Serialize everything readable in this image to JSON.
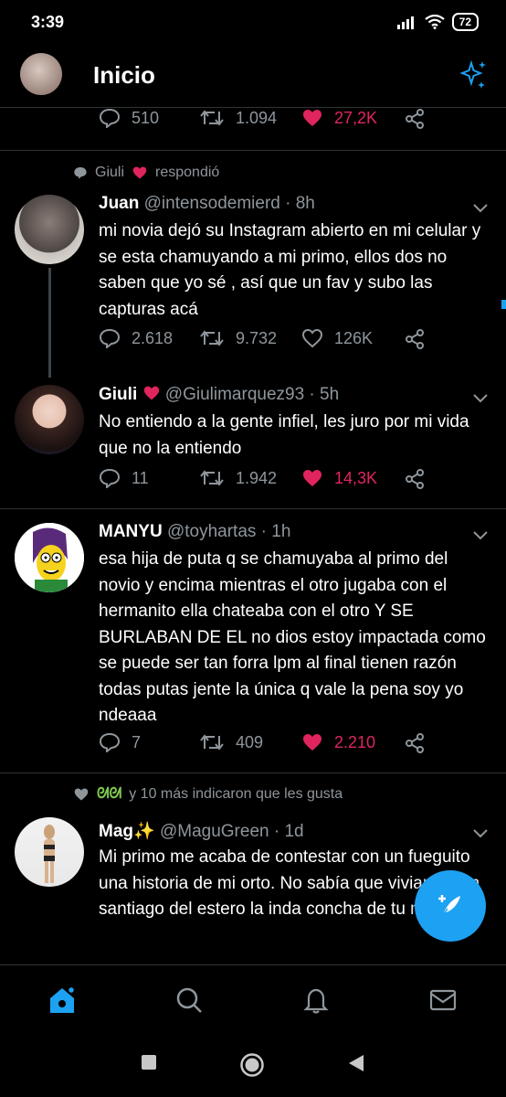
{
  "status_bar": {
    "time": "3:39",
    "battery": "72"
  },
  "header": {
    "title": "Inicio"
  },
  "top_stats": {
    "replies": "510",
    "retweets": "1.094",
    "likes": "27,2K"
  },
  "tweets": [
    {
      "context": "respondió",
      "context_user": "Giuli",
      "name": "Juan",
      "handle": "@intensodemierd · 8h",
      "text": "mi novia dejó su Instagram abierto en mi celular y se esta chamuyando a mi primo, ellos dos no saben que yo sé , así que un fav y subo las capturas acá",
      "replies": "2.618",
      "retweets": "9.732",
      "likes": "126K",
      "liked": false
    },
    {
      "name": "Giuli",
      "handle": "@Giulimarquez93 · 5h",
      "text": "No entiendo a la gente infiel, les juro por mi vida que no la entiendo",
      "replies": "11",
      "retweets": "1.942",
      "likes": "14,3K",
      "liked": true
    },
    {
      "name": "MANYU",
      "handle": "@toyhartas · 1h",
      "text": "esa hija de puta q se chamuyaba al primo del novio y encima mientras el otro jugaba con el hermanito ella chateaba con el otro Y SE BURLABAN DE EL no dios estoy impactada como se puede ser tan forra lpm al final tienen razón todas putas jente la única q vale la pena soy yo ndeaaa",
      "replies": "7",
      "retweets": "409",
      "likes": "2.210",
      "liked": true
    },
    {
      "context": "y 10 más indicaron que les gusta",
      "context_prefix": "ᘛᘛ",
      "name": "Mag",
      "handle": "@MaguGreen · 1d",
      "text": "Mi primo me acaba de contestar con un fueguito una historia de mi orto. No sabía que viviamos en santiago del estero la inda concha de tu madre"
    }
  ],
  "colors": {
    "accent": "#1da1f2",
    "like": "#e0245e",
    "muted": "#8e969c",
    "background": "#000000"
  },
  "icons": [
    "reply-icon",
    "retweet-icon",
    "heart-icon",
    "share-icon",
    "sparkle-icon",
    "home-icon",
    "search-icon",
    "bell-icon",
    "mail-icon",
    "compose-icon"
  ]
}
